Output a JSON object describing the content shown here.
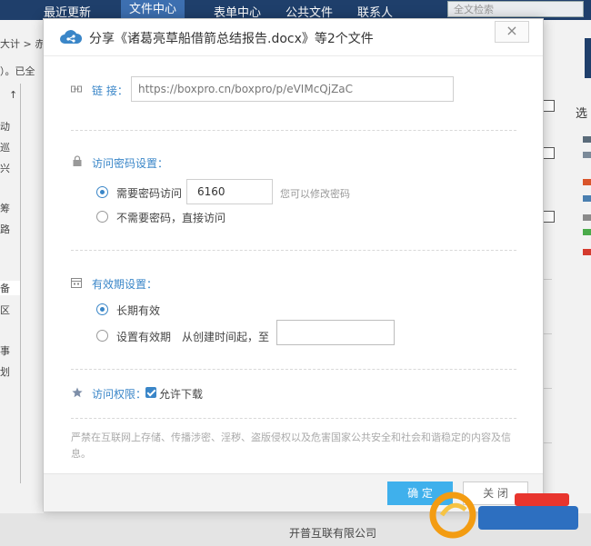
{
  "topnav": {
    "items": [
      "最近更新",
      "文件中心",
      "表单中心",
      "公共文件",
      "联系人"
    ],
    "active_index": 1,
    "search_placeholder": "全文检索"
  },
  "background_left": {
    "fragments": [
      "大计 > 赤",
      "）。已全",
      "↑",
      "动",
      "巡",
      "兴",
      "筹",
      "路",
      "备",
      "区",
      "事",
      "划"
    ]
  },
  "background_right": {
    "fragments": [
      "选"
    ]
  },
  "footer": {
    "company": "开普互联有限公司"
  },
  "dialog": {
    "title": "分享《诸葛亮草船借箭总结报告.docx》等2个文件",
    "close_label": "×",
    "link": {
      "label": "链  接：",
      "value": "https://boxpro.cn/boxpro/p/eVIMcQjZaC"
    },
    "password": {
      "section_label": "访问密码设置：",
      "need_label": "需要密码访问",
      "value": "6160",
      "hint": "您可以修改密码",
      "no_need_label": "不需要密码，直接访问",
      "selected": "need"
    },
    "validity": {
      "section_label": "有效期设置：",
      "long_term_label": "长期有效",
      "set_label": "设置有效期",
      "from_label": "从创建时间起，至",
      "date_value": "",
      "selected": "long_term"
    },
    "permission": {
      "section_label": "访问权限：",
      "allow_download_label": "允许下载",
      "allow_download": true
    },
    "notice": "严禁在互联网上存储、传播涉密、淫秽、盗版侵权以及危害国家公共安全和社会和谐稳定的内容及信息。",
    "ok_label": "确 定",
    "cancel_label": "关 闭"
  },
  "colors": {
    "nav_bg": "#1f3f6b",
    "accent": "#3a86c8",
    "ok_button": "#3fb0ec"
  },
  "icons": [
    "cloud-share-icon",
    "link-icon",
    "lock-icon",
    "calendar-icon",
    "star-icon",
    "close-icon"
  ]
}
